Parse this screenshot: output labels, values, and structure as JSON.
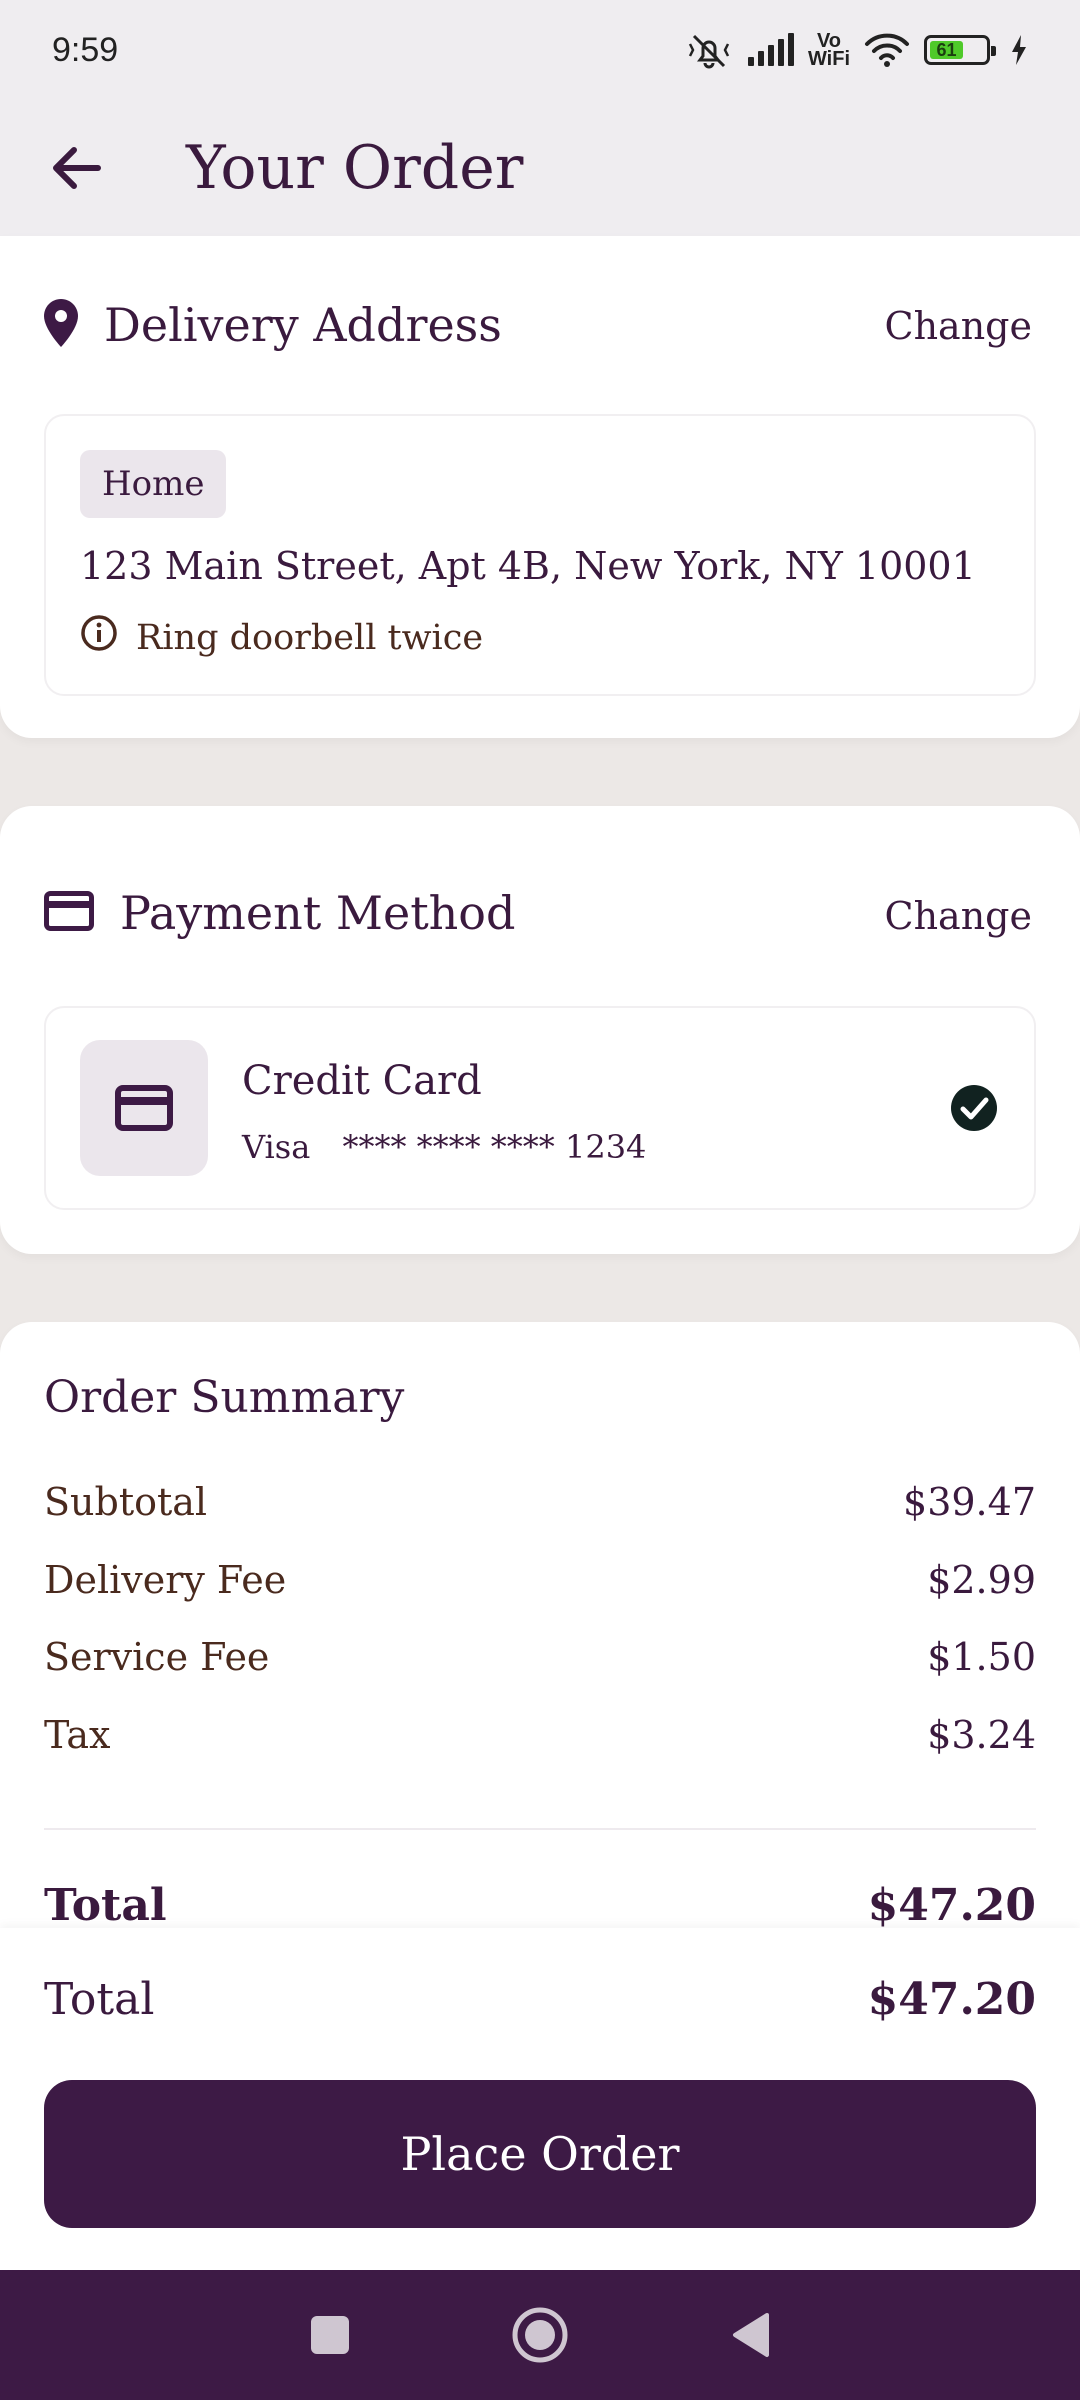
{
  "status_bar": {
    "time": "9:59",
    "vowifi_top": "Vo",
    "vowifi_bottom": "WiFi",
    "battery_level": "61",
    "icons": [
      "mute-icon",
      "signal-icon",
      "vowifi-icon",
      "wifi-icon",
      "battery-icon",
      "charging-icon"
    ]
  },
  "app_bar": {
    "title": "Your Order",
    "back_icon": "arrow-left-icon"
  },
  "delivery": {
    "title": "Delivery Address",
    "change_label": "Change",
    "icon": "location-pin-icon",
    "tag": "Home",
    "address": "123 Main Street, Apt 4B, New York, NY 10001",
    "note": "Ring doorbell twice",
    "note_icon": "info-icon"
  },
  "payment": {
    "title": "Payment Method",
    "change_label": "Change",
    "icon": "credit-card-icon",
    "method_name": "Credit Card",
    "brand": "Visa",
    "masked_number": "**** **** **** 1234",
    "selected": true,
    "selected_icon": "check-circle-icon"
  },
  "summary": {
    "title": "Order Summary",
    "rows": [
      {
        "label": "Subtotal",
        "value": "$39.47"
      },
      {
        "label": "Delivery Fee",
        "value": "$2.99"
      },
      {
        "label": "Service Fee",
        "value": "$1.50"
      },
      {
        "label": "Tax",
        "value": "$3.24"
      }
    ],
    "total_label": "Total",
    "total_value": "$47.20"
  },
  "bottom_panel": {
    "total_label": "Total",
    "total_value": "$47.20",
    "place_order_label": "Place Order"
  },
  "nav_bar": {
    "items": [
      "recents-square-icon",
      "home-circle-icon",
      "back-triangle-icon"
    ]
  },
  "colors": {
    "primary": "#3d1a45",
    "card": "#ffffff",
    "background": "#ece8e6",
    "chip": "#ebe6ec"
  }
}
